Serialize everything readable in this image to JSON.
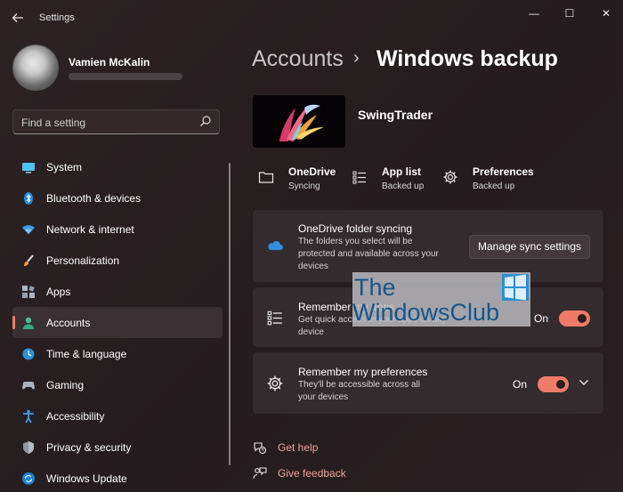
{
  "window": {
    "title": "Settings",
    "back_icon": "arrow-left-icon",
    "controls": {
      "minimize": "—",
      "maximize": "☐",
      "close": "✕"
    }
  },
  "profile": {
    "name": "Vamien McKalin"
  },
  "search": {
    "placeholder": "Find a setting"
  },
  "nav": {
    "items": [
      {
        "label": "System",
        "icon": "monitor-icon"
      },
      {
        "label": "Bluetooth & devices",
        "icon": "bluetooth-icon"
      },
      {
        "label": "Network & internet",
        "icon": "wifi-icon"
      },
      {
        "label": "Personalization",
        "icon": "brush-icon"
      },
      {
        "label": "Apps",
        "icon": "apps-icon"
      },
      {
        "label": "Accounts",
        "icon": "person-icon",
        "selected": true
      },
      {
        "label": "Time & language",
        "icon": "globe-clock-icon"
      },
      {
        "label": "Gaming",
        "icon": "gamepad-icon"
      },
      {
        "label": "Accessibility",
        "icon": "accessibility-icon"
      },
      {
        "label": "Privacy & security",
        "icon": "shield-icon"
      },
      {
        "label": "Windows Update",
        "icon": "update-icon"
      }
    ]
  },
  "header": {
    "parent": "Accounts",
    "separator": "›",
    "current": "Windows backup"
  },
  "device": {
    "name": "SwingTrader"
  },
  "status": [
    {
      "title": "OneDrive",
      "subtitle": "Syncing",
      "icon": "folder-icon"
    },
    {
      "title": "App list",
      "subtitle": "Backed up",
      "icon": "list-icon"
    },
    {
      "title": "Preferences",
      "subtitle": "Backed up",
      "icon": "gear-icon"
    }
  ],
  "cards": {
    "onedrive": {
      "title": "OneDrive folder syncing",
      "desc_lines": [
        "The folders you select will be",
        "protected and available across your",
        "devices"
      ],
      "button": "Manage sync settings",
      "icon": "cloud-icon"
    },
    "apps": {
      "title": "Remember my apps",
      "desc_lines": [
        "Get quick access to your apps on any",
        "device"
      ],
      "toggle_label": "On",
      "toggle_on": true,
      "icon": "list-icon"
    },
    "preferences": {
      "title": "Remember my preferences",
      "desc_lines": [
        "They'll be accessible across all",
        "your devices"
      ],
      "toggle_label": "On",
      "toggle_on": true,
      "icon": "gear-icon"
    }
  },
  "links": {
    "help": "Get help",
    "feedback": "Give feedback"
  },
  "watermark": {
    "line1": "The",
    "line2": "WindowsClub"
  },
  "colors": {
    "accent": "#f07a68",
    "link": "#f3a294",
    "card": "#342b2e"
  }
}
